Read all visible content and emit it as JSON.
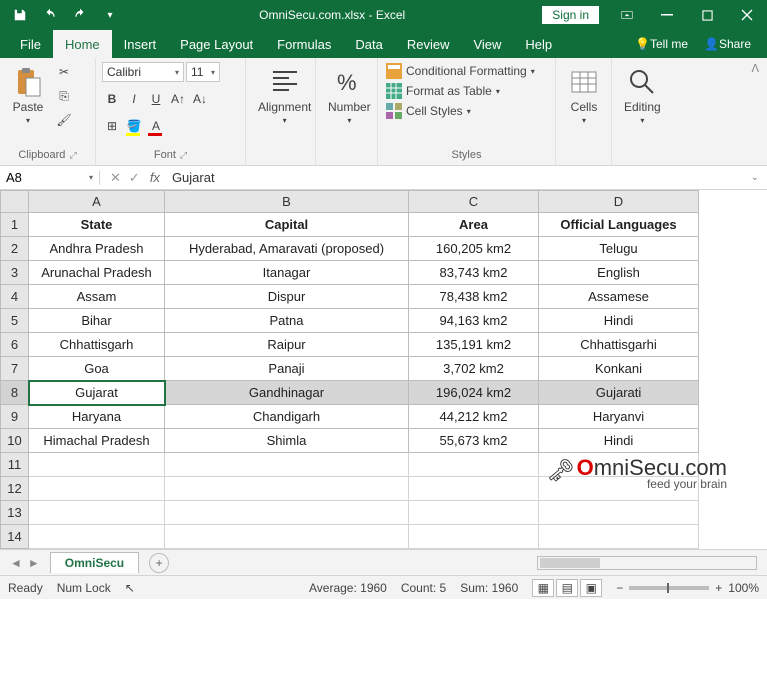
{
  "titlebar": {
    "title": "OmniSecu.com.xlsx - Excel",
    "signin": "Sign in"
  },
  "tabs": {
    "file": "File",
    "home": "Home",
    "insert": "Insert",
    "pagelayout": "Page Layout",
    "formulas": "Formulas",
    "data": "Data",
    "review": "Review",
    "view": "View",
    "help": "Help",
    "tellme": "Tell me",
    "share": "Share"
  },
  "ribbon": {
    "clipboard": {
      "label": "Clipboard",
      "paste": "Paste"
    },
    "font": {
      "label": "Font",
      "name": "Calibri",
      "size": "11",
      "bold": "B",
      "italic": "I",
      "underline": "U"
    },
    "alignment": {
      "label": "Alignment"
    },
    "number": {
      "label": "Number"
    },
    "styles": {
      "label": "Styles",
      "cond": "Conditional Formatting",
      "table": "Format as Table",
      "cell": "Cell Styles"
    },
    "cells": {
      "label": "Cells"
    },
    "editing": {
      "label": "Editing"
    }
  },
  "namebox": "A8",
  "formula": "Gujarat",
  "columns": [
    "A",
    "B",
    "C",
    "D"
  ],
  "headers": {
    "state": "State",
    "capital": "Capital",
    "area": "Area",
    "lang": "Official Languages"
  },
  "rows": [
    {
      "n": "2",
      "state": "Andhra Pradesh",
      "capital": "Hyderabad, Amaravati (proposed)",
      "area": "160,205 km2",
      "lang": "Telugu"
    },
    {
      "n": "3",
      "state": "Arunachal Pradesh",
      "capital": "Itanagar",
      "area": "83,743 km2",
      "lang": "English"
    },
    {
      "n": "4",
      "state": "Assam",
      "capital": "Dispur",
      "area": "78,438 km2",
      "lang": "Assamese"
    },
    {
      "n": "5",
      "state": "Bihar",
      "capital": "Patna",
      "area": "94,163 km2",
      "lang": "Hindi"
    },
    {
      "n": "6",
      "state": "Chhattisgarh",
      "capital": "Raipur",
      "area": "135,191 km2",
      "lang": "Chhattisgarhi"
    },
    {
      "n": "7",
      "state": "Goa",
      "capital": "Panaji",
      "area": "3,702 km2",
      "lang": "Konkani"
    },
    {
      "n": "8",
      "state": "Gujarat",
      "capital": "Gandhinagar",
      "area": "196,024 km2",
      "lang": "Gujarati"
    },
    {
      "n": "9",
      "state": "Haryana",
      "capital": "Chandigarh",
      "area": "44,212 km2",
      "lang": "Haryanvi"
    },
    {
      "n": "10",
      "state": "Himachal Pradesh",
      "capital": "Shimla",
      "area": "55,673 km2",
      "lang": "Hindi"
    }
  ],
  "emptyrows": [
    "11",
    "12",
    "13",
    "14"
  ],
  "selected_row": "8",
  "sheet": {
    "name": "OmniSecu"
  },
  "status": {
    "ready": "Ready",
    "numlock": "Num Lock",
    "average": "Average: 1960",
    "count": "Count: 5",
    "sum": "Sum: 1960",
    "zoom": "100%"
  },
  "watermark": {
    "brand_prefix": "O",
    "brand_rest": "mniSecu.com",
    "tagline": "feed your brain"
  }
}
